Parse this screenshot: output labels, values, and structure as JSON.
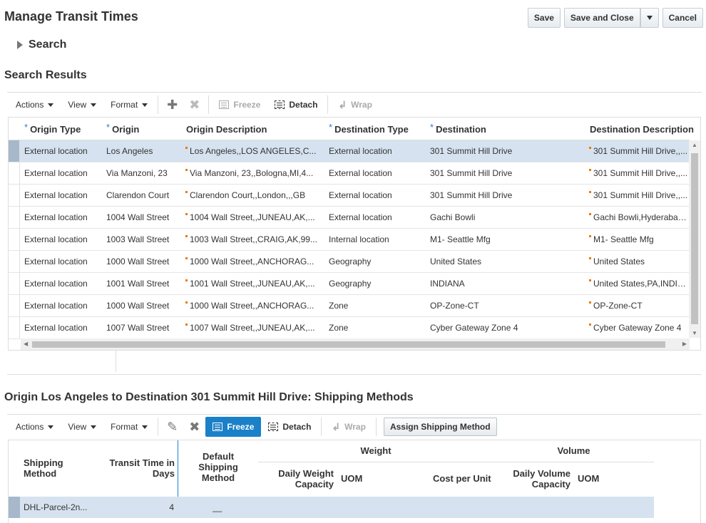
{
  "page": {
    "title": "Manage Transit Times"
  },
  "buttons": {
    "save": "Save",
    "save_close": "Save and Close",
    "cancel": "Cancel"
  },
  "search": {
    "label": "Search"
  },
  "results": {
    "title": "Search Results",
    "toolbar": {
      "actions": "Actions",
      "view": "View",
      "format": "Format",
      "freeze": "Freeze",
      "detach": "Detach",
      "wrap": "Wrap"
    },
    "columns": [
      "Origin Type",
      "Origin",
      "Origin Description",
      "Destination Type",
      "Destination",
      "Destination Description"
    ],
    "rows": [
      [
        "External location",
        "Los Angeles",
        "Los Angeles,,LOS ANGELES,C...",
        "External location",
        "301 Summit Hill Drive",
        "301 Summit Hill Drive,,..."
      ],
      [
        "External location",
        "Via Manzoni, 23",
        "Via Manzoni, 23,,Bologna,MI,4...",
        "External location",
        "301 Summit Hill Drive",
        "301 Summit Hill Drive,,..."
      ],
      [
        "External location",
        "Clarendon Court",
        "Clarendon Court,,London,,,GB",
        "External location",
        "301 Summit Hill Drive",
        "301 Summit Hill Drive,,..."
      ],
      [
        "External location",
        "1004 Wall Street",
        "1004 Wall Street,,JUNEAU,AK,...",
        "External location",
        "Gachi Bowli",
        "Gachi Bowli,Hyderabad..."
      ],
      [
        "External location",
        "1003 Wall Street",
        "1003 Wall Street,,CRAIG,AK,99...",
        "Internal location",
        "M1- Seattle Mfg",
        "M1- Seattle Mfg"
      ],
      [
        "External location",
        "1000 Wall Street",
        "1000 Wall Street,,ANCHORAG...",
        "Geography",
        "United States",
        "United States"
      ],
      [
        "External location",
        "1001 Wall Street",
        "1001 Wall Street,,JUNEAU,AK,...",
        "Geography",
        "INDIANA",
        "United States,PA,INDIA..."
      ],
      [
        "External location",
        "1000 Wall Street",
        "1000 Wall Street,,ANCHORAG...",
        "Zone",
        "OP-Zone-CT",
        "OP-Zone-CT"
      ],
      [
        "External location",
        "1007 Wall Street",
        "1007 Wall Street,,JUNEAU,AK,...",
        "Zone",
        "Cyber Gateway Zone 4",
        "Cyber Gateway Zone 4"
      ]
    ]
  },
  "shipping": {
    "title": "Origin Los Angeles to Destination 301 Summit Hill Drive: Shipping Methods",
    "toolbar": {
      "actions": "Actions",
      "view": "View",
      "format": "Format",
      "freeze": "Freeze",
      "detach": "Detach",
      "wrap": "Wrap",
      "assign": "Assign Shipping Method"
    },
    "headers": {
      "shipping_method": "Shipping Method",
      "transit_time": "Transit Time in Days",
      "default_method": "Default Shipping Method",
      "weight_group": "Weight",
      "daily_weight": "Daily Weight Capacity",
      "weight_uom": "UOM",
      "cost_per_unit": "Cost per Unit",
      "volume_group": "Volume",
      "daily_volume": "Daily Volume Capacity",
      "volume_uom": "UOM"
    },
    "row": {
      "method": "DHL-Parcel-2n...",
      "days": "4",
      "default": "__"
    }
  }
}
